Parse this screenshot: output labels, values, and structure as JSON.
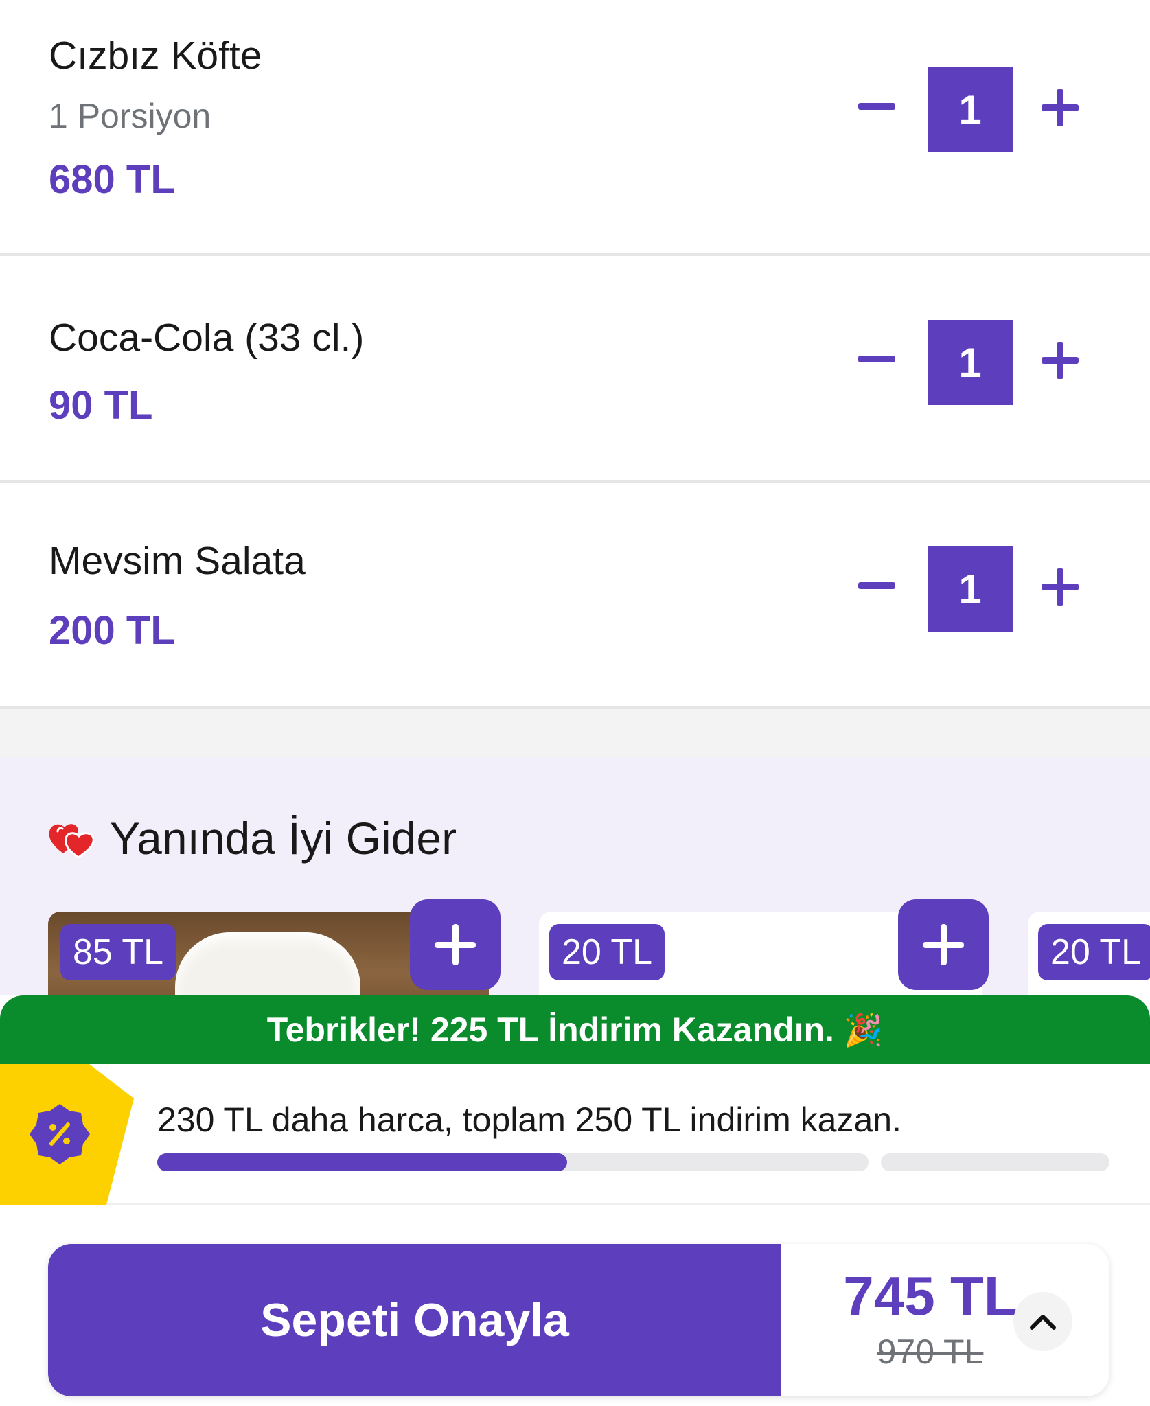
{
  "colors": {
    "brand": "#5d3ebc",
    "success": "#0a8c2d",
    "badge_yellow": "#fdd000",
    "text": "#191919",
    "muted": "#6f7378"
  },
  "cart": {
    "items": [
      {
        "name": "Cızbız Köfte",
        "sub": "1 Porsiyon",
        "price": "680 TL",
        "quantity": "1"
      },
      {
        "name": "Coca-Cola (33 cl.)",
        "price": "90 TL",
        "quantity": "1"
      },
      {
        "name": "Mevsim Salata",
        "price": "200 TL",
        "quantity": "1"
      }
    ]
  },
  "suggestions": {
    "title": "Yanında İyi Gider",
    "icon": "hearts-icon",
    "products": [
      {
        "price": "85 TL"
      },
      {
        "price": "20 TL"
      },
      {
        "price": "20 TL"
      }
    ]
  },
  "promo": {
    "banner_text": "Tebrikler! 225 TL İndirim Kazandın.",
    "banner_emoji": "🎉",
    "progress_text": "230 TL daha harca, toplam 250 TL indirim kazan.",
    "progress_fraction": 0.576
  },
  "checkout": {
    "button_label": "Sepeti Onayla",
    "total": "745 TL",
    "original_total": "970 TL"
  }
}
